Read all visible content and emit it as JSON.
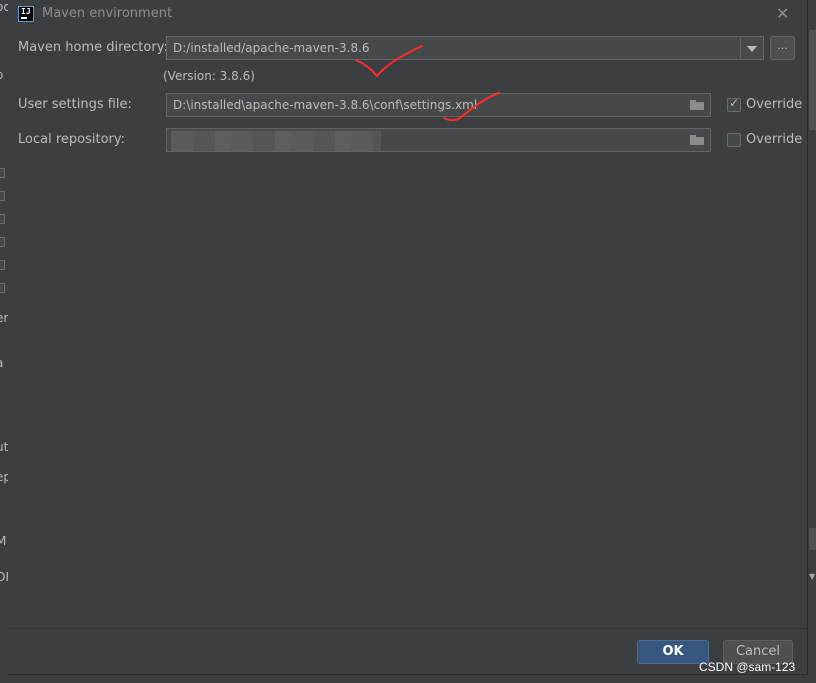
{
  "dialog": {
    "title": "Maven environment",
    "icon": "intellij-icon",
    "close_icon": "close-icon"
  },
  "form": {
    "maven_home": {
      "label": "Maven home directory:",
      "value": "D:/installed/apache-maven-3.8.6",
      "browse_label": "..."
    },
    "version_text": "(Version: 3.8.6)",
    "user_settings": {
      "label": "User settings file:",
      "value": "D:\\installed\\apache-maven-3.8.6\\conf\\settings.xml",
      "override_label": "Override",
      "override_checked": true
    },
    "local_repo": {
      "label": "Local repository:",
      "value": "",
      "override_label": "Override",
      "override_checked": false
    }
  },
  "footer": {
    "ok_label": "OK",
    "cancel_label": "Cancel"
  },
  "watermark": "CSDN @sam-123",
  "background_fragments": [
    "oc",
    "o",
    "er",
    "a",
    "ut",
    "ep",
    "M",
    "OK"
  ],
  "colors": {
    "background": "#3c3f41",
    "field": "#45494a",
    "primary_button": "#365880",
    "annotation": "#ff2a2a"
  }
}
